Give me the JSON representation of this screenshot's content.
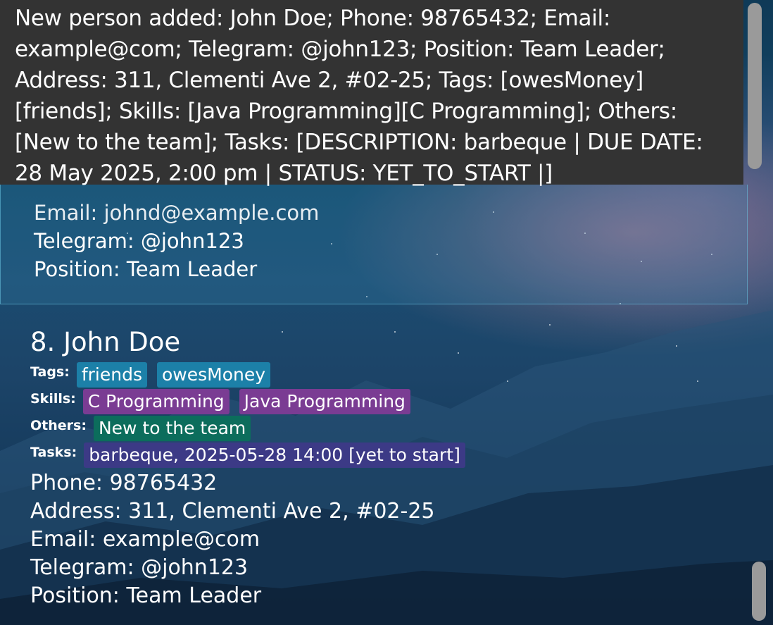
{
  "result": {
    "message": "New person added: John Doe; Phone: 98765432; Email: example@com; Telegram: @john123; Position: Team Leader; Address: 311, Clementi Ave 2, #02-25; Tags: [owesMoney][friends]; Skills: [Java Programming][C Programming]; Others: [New to the team]; Tasks: [DESCRIPTION: barbeque | DUE DATE: 28 May 2025, 2:00 pm | STATUS: YET_TO_START |]"
  },
  "previous_card": {
    "email": "Email: johnd@example.com",
    "telegram": "Telegram: @john123",
    "position": "Position: Team Leader"
  },
  "card": {
    "title": "8. John Doe",
    "tags_label": "Tags:",
    "tags": [
      "friends",
      "owesMoney"
    ],
    "skills_label": "Skills:",
    "skills": [
      "C Programming",
      "Java Programming"
    ],
    "others_label": "Others:",
    "others": [
      "New to the team"
    ],
    "tasks_label": "Tasks:",
    "tasks": [
      "barbeque, 2025-05-28 14:00 [yet to start]"
    ],
    "phone": "Phone: 98765432",
    "address": "Address: 311, Clementi Ave 2, #02-25",
    "email": "Email: example@com",
    "telegram": "Telegram: @john123",
    "position": "Position: Team Leader"
  },
  "colors": {
    "result_bg": "#333333",
    "tag": "#1c80a8",
    "skill": "#7a3c93",
    "other": "#0c6d5c",
    "task": "#3c3a86",
    "scrollbar": "#9a9a9a"
  }
}
